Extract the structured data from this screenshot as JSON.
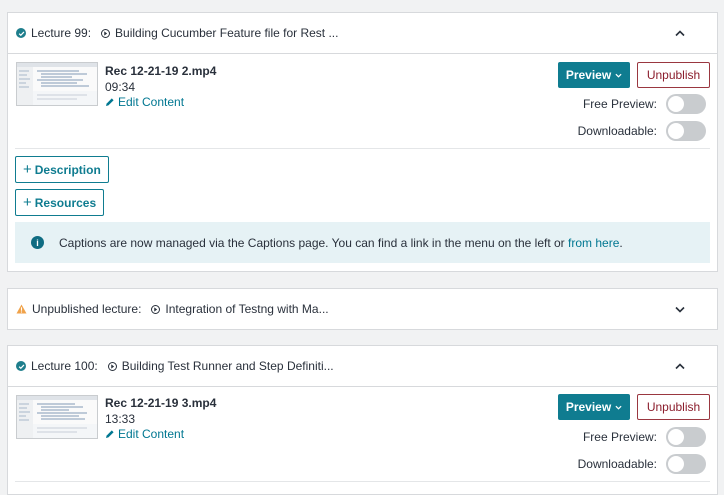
{
  "lectures": [
    {
      "label": "Lecture 99:",
      "title": "Building Cucumber Feature file for Rest ...",
      "file_name": "Rec 12-21-19 2.mp4",
      "duration": "09:34",
      "edit_label": "Edit Content",
      "preview_label": "Preview",
      "unpublish_label": "Unpublish",
      "free_preview_label": "Free Preview:",
      "downloadable_label": "Downloadable:",
      "description_label": "Description",
      "resources_label": "Resources",
      "info_text": "Captions are now managed via the Captions page. You can find a link in the menu on the left or ",
      "info_link": "from here",
      "info_end": "."
    },
    {
      "label": "Unpublished lecture:",
      "title": "Integration of Testng with Ma..."
    },
    {
      "label": "Lecture 100:",
      "title": "Building Test Runner and Step Definiti...",
      "file_name": "Rec 12-21-19 3.mp4",
      "duration": "13:33",
      "edit_label": "Edit Content",
      "preview_label": "Preview",
      "unpublish_label": "Unpublish",
      "free_preview_label": "Free Preview:",
      "downloadable_label": "Downloadable:"
    }
  ],
  "colors": {
    "accent": "#0f7c90",
    "danger": "#8b1d2c",
    "success": "#1e7e8c",
    "warning": "#f0a24a"
  },
  "icons": [
    "check-circle-icon",
    "play-circle-icon",
    "warning-icon",
    "chevron-up-icon",
    "chevron-down-icon",
    "pencil-icon",
    "plus-icon",
    "info-icon"
  ]
}
